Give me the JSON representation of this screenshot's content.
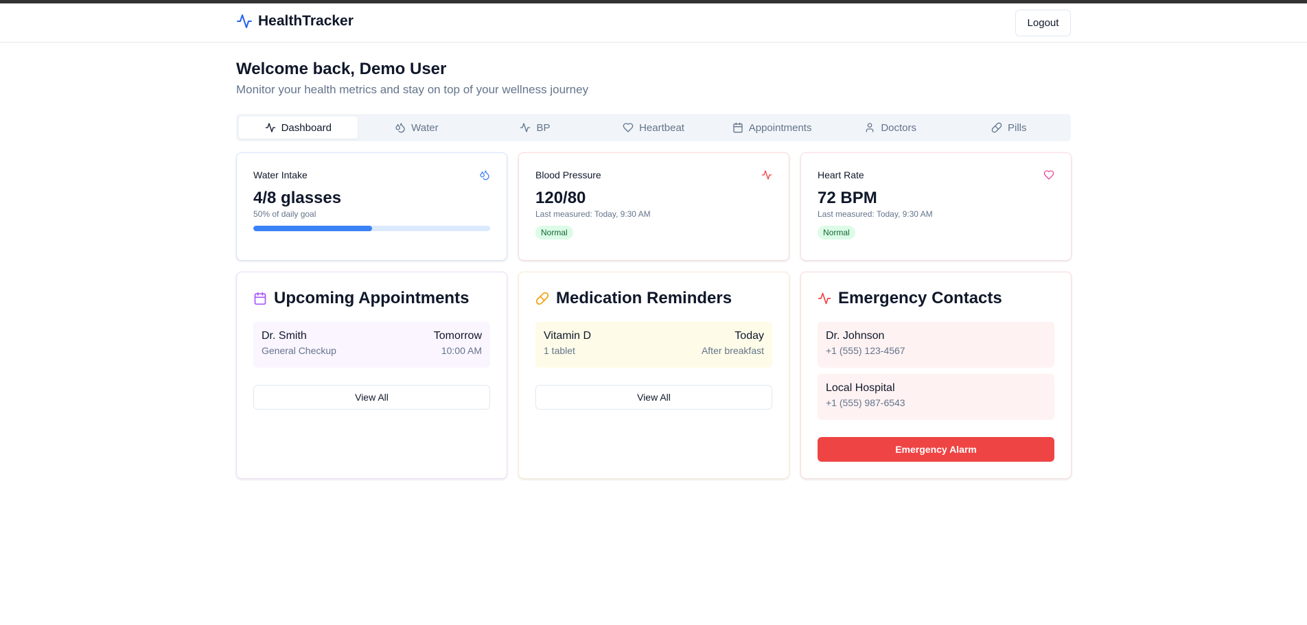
{
  "app": {
    "name": "HealthTracker",
    "logout_label": "Logout"
  },
  "header": {
    "welcome": "Welcome back, Demo User",
    "subtitle": "Monitor your health metrics and stay on top of your wellness journey"
  },
  "tabs": [
    {
      "label": "Dashboard",
      "icon": "activity-icon",
      "active": true
    },
    {
      "label": "Water",
      "icon": "droplets-icon",
      "active": false
    },
    {
      "label": "BP",
      "icon": "activity-icon",
      "active": false
    },
    {
      "label": "Heartbeat",
      "icon": "heart-icon",
      "active": false
    },
    {
      "label": "Appointments",
      "icon": "calendar-icon",
      "active": false
    },
    {
      "label": "Doctors",
      "icon": "user-icon",
      "active": false
    },
    {
      "label": "Pills",
      "icon": "pill-icon",
      "active": false
    }
  ],
  "metrics": {
    "water": {
      "label": "Water Intake",
      "value": "4/8 glasses",
      "sub": "50% of daily goal",
      "progress": 0.5,
      "icon": "droplets-icon",
      "color": "#3b82f6"
    },
    "bp": {
      "label": "Blood Pressure",
      "value": "120/80",
      "sub": "Last measured: Today, 9:30 AM",
      "badge": "Normal",
      "icon": "activity-icon",
      "color": "#ef4444"
    },
    "heart": {
      "label": "Heart Rate",
      "value": "72 BPM",
      "sub": "Last measured: Today, 9:30 AM",
      "badge": "Normal",
      "icon": "heart-icon",
      "color": "#ec4899"
    }
  },
  "appointments": {
    "title": "Upcoming Appointments",
    "icon": "calendar-icon",
    "color": "#a855f7",
    "items": [
      {
        "name": "Dr. Smith",
        "detail": "General Checkup",
        "when": "Tomorrow",
        "time": "10:00 AM"
      }
    ],
    "view_all": "View All"
  },
  "medications": {
    "title": "Medication Reminders",
    "icon": "pill-icon",
    "color": "#f59e0b",
    "items": [
      {
        "name": "Vitamin D",
        "detail": "1 tablet",
        "when": "Today",
        "time": "After breakfast"
      }
    ],
    "view_all": "View All"
  },
  "emergency": {
    "title": "Emergency Contacts",
    "icon": "activity-icon",
    "color": "#ef4444",
    "items": [
      {
        "name": "Dr. Johnson",
        "phone": "+1 (555) 123-4567"
      },
      {
        "name": "Local Hospital",
        "phone": "+1 (555) 987-6543"
      }
    ],
    "alarm_label": "Emergency Alarm"
  }
}
